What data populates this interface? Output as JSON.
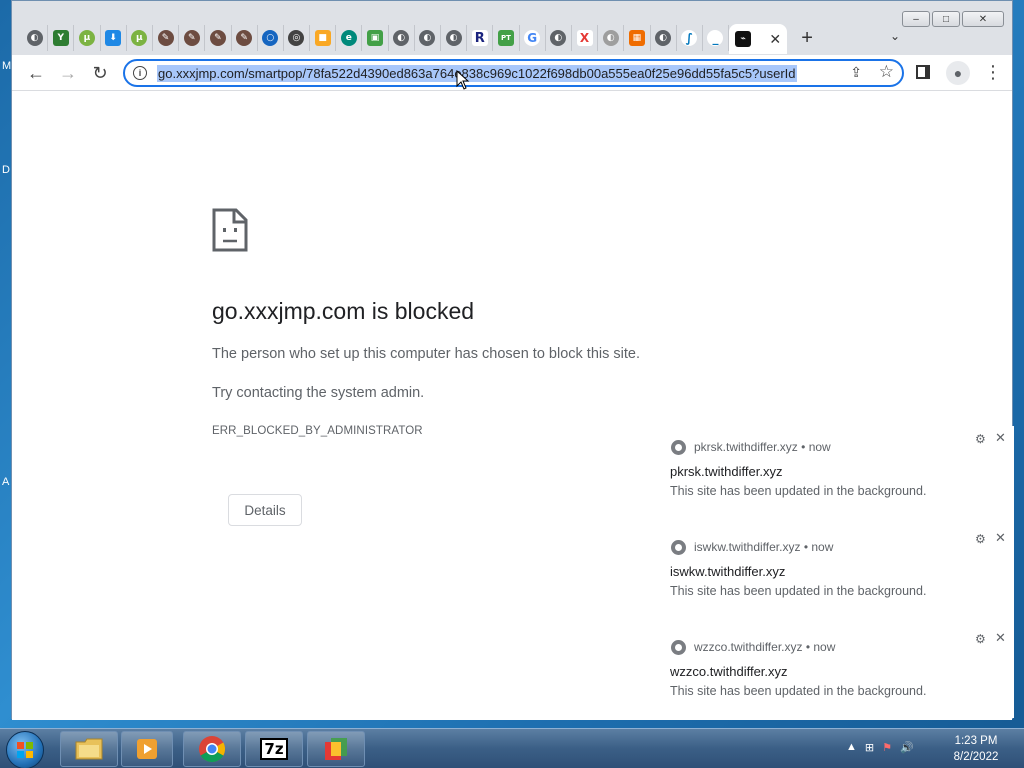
{
  "desktop": {
    "edge_letters": [
      "M",
      "D",
      "A"
    ]
  },
  "window": {
    "controls": {
      "minimize": "–",
      "maximize": "□",
      "close": "✕"
    }
  },
  "tabs": {
    "favicons": [
      "◐",
      "Y",
      "μ",
      "⬇",
      "μ",
      "✎",
      "✎",
      "✎",
      "✎",
      "○",
      "◎",
      "■",
      "e",
      "▣",
      "◐",
      "◐",
      "◐",
      "R",
      "PT",
      "G",
      "◐",
      "X",
      "◐",
      "▦",
      "◐",
      "∫",
      "_"
    ],
    "active_favicon": "⌁",
    "active_close": "✕",
    "new_tab": "+",
    "tab_search": "⌄"
  },
  "toolbar": {
    "back": "←",
    "forward": "→",
    "reload": "↻",
    "url": "go.xxxjmp.com/smartpop/78fa522d4390ed863a764e838c969c1022f698db00a555ea0f25e96dd55fa5c5?userId",
    "info_icon": "i",
    "share_icon": "⇪",
    "star_icon": "☆",
    "profile_icon": "●",
    "menu_icon": "⋮"
  },
  "error_page": {
    "title": "go.xxxjmp.com is blocked",
    "description": "The person who set up this computer has chosen to block this site.",
    "suggestion": "Try contacting the system admin.",
    "error_code": "ERR_BLOCKED_BY_ADMINISTRATOR",
    "details_button": "Details"
  },
  "notifications": [
    {
      "origin": "pkrsk.twithdiffer.xyz",
      "time": "now",
      "title": "pkrsk.twithdiffer.xyz",
      "body": "This site has been updated in the background."
    },
    {
      "origin": "iswkw.twithdiffer.xyz",
      "time": "now",
      "title": "iswkw.twithdiffer.xyz",
      "body": "This site has been updated in the background."
    },
    {
      "origin": "wzzco.twithdiffer.xyz",
      "time": "now",
      "title": "wzzco.twithdiffer.xyz",
      "body": "This site has been updated in the background."
    }
  ],
  "notification_controls": {
    "gear": "⚙",
    "close": "✕",
    "separator": "•"
  },
  "taskbar": {
    "apps": [
      "file-explorer",
      "media-player",
      "chrome",
      "7zip",
      "office"
    ],
    "app_labels": {
      "sevenzip": "7z"
    },
    "tray_icons": [
      "▲",
      "⊞",
      "⚑",
      "🔊"
    ],
    "time": "1:23 PM",
    "date": "8/2/2022"
  },
  "colors": {
    "accent": "#1a73e8",
    "url_selection": "#a8c7fa",
    "text_primary": "#202124",
    "text_secondary": "#5f6368"
  }
}
